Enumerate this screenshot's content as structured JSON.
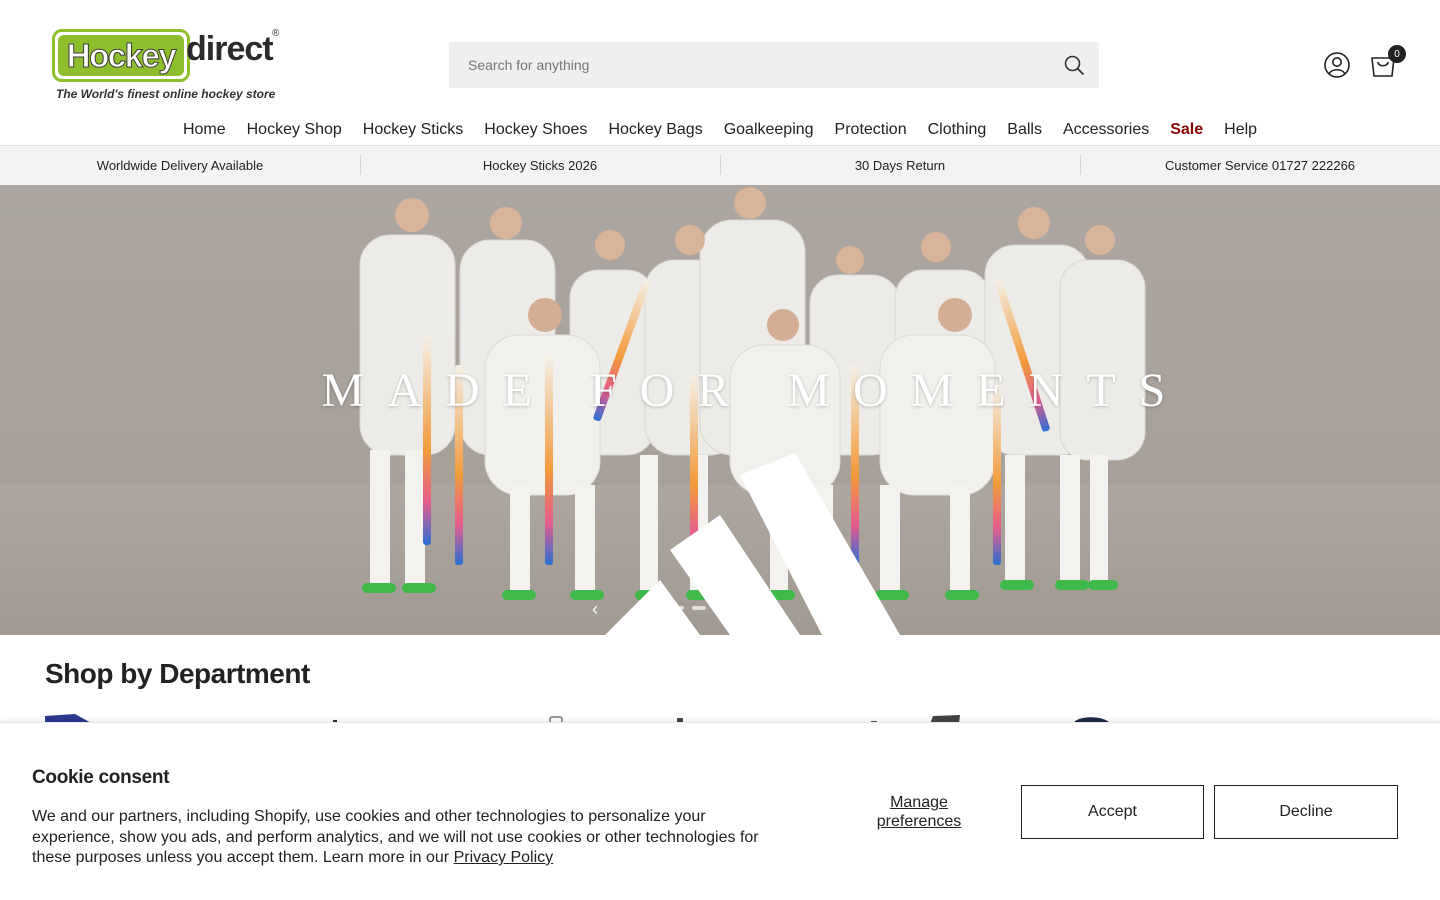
{
  "header": {
    "logo": {
      "word_hockey": "Hockey",
      "word_direct": "direct",
      "registered": "®",
      "tagline": "The World's finest online hockey store"
    },
    "search": {
      "placeholder": "Search for anything"
    },
    "cart": {
      "count": "0"
    }
  },
  "nav": {
    "items": [
      "Home",
      "Hockey Shop",
      "Hockey Sticks",
      "Hockey Shoes",
      "Hockey Bags",
      "Goalkeeping",
      "Protection",
      "Clothing",
      "Balls",
      "Accessories",
      "Sale",
      "Help"
    ]
  },
  "usp": [
    "Worldwide Delivery Available",
    "Hockey Sticks 2026",
    "30 Days Return",
    "Customer Service 01727 222266"
  ],
  "hero": {
    "title": "MADE FOR MOMENTS",
    "slide_count": 5
  },
  "department": {
    "title": "Shop by Department"
  },
  "cookie": {
    "title": "Cookie consent",
    "text": "We and our partners, including Shopify, use cookies and other technologies to personalize your experience, show you ads, and perform analytics, and we will not use cookies or other technologies for these purposes unless you accept them. Learn more in our ",
    "privacy_link": "Privacy Policy",
    "manage": "Manage preferences",
    "accept": "Accept",
    "decline": "Decline"
  },
  "colors": {
    "logo_green": "#8dbf2c",
    "sale": "#8b0000",
    "usp_bg": "#f3f3f3"
  }
}
